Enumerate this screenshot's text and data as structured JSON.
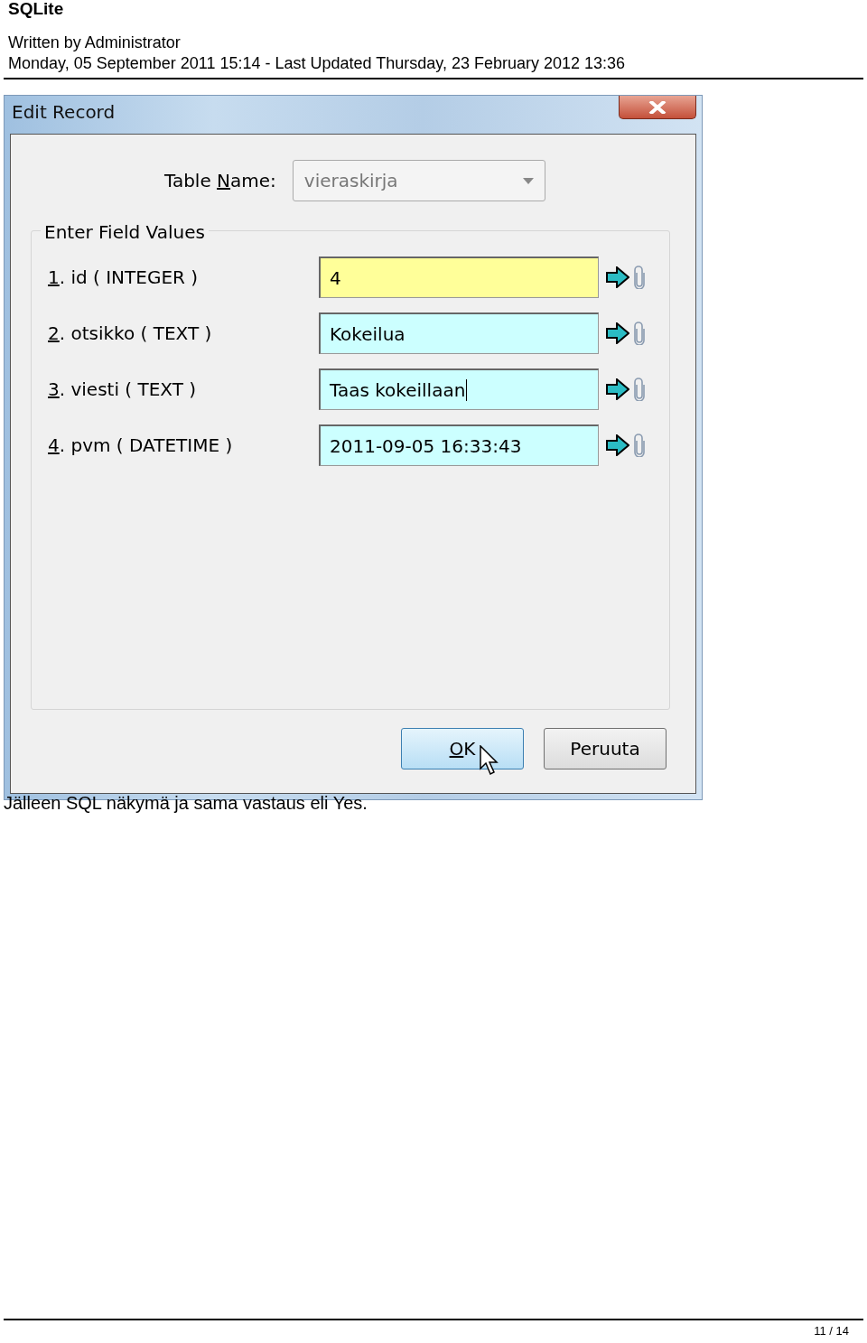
{
  "header": {
    "title": "SQLite",
    "author": "Written by Administrator",
    "dates": "Monday, 05 September 2011 15:14 - Last Updated Thursday, 23 February 2012 13:36"
  },
  "dialog": {
    "title": "Edit Record",
    "table_name_label": {
      "before": "Table ",
      "mnemonic": "N",
      "after": "ame:"
    },
    "table_name": "vieraskirja",
    "group_title": "Enter Field Values",
    "fields": [
      {
        "mnemonic": "1",
        "label": ". id ( INTEGER )",
        "value": "4",
        "color": "#ffff99",
        "focused": false
      },
      {
        "mnemonic": "2",
        "label": ". otsikko ( TEXT )",
        "value": "Kokeilua",
        "color": "#ccffff",
        "focused": false
      },
      {
        "mnemonic": "3",
        "label": ". viesti ( TEXT )",
        "value": "Taas kokeillaan",
        "color": "#ccffff",
        "focused": true
      },
      {
        "mnemonic": "4",
        "label": ". pvm ( DATETIME )",
        "value": "2011-09-05 16:33:43",
        "color": "#ccffff",
        "focused": false
      }
    ],
    "buttons": [
      {
        "mnemonic": "O",
        "label": "K",
        "default": true
      },
      {
        "label": "Peruuta",
        "default": false
      }
    ]
  },
  "caption": "Jälleen SQL näkymä ja sama vastaus eli Yes.",
  "footer": {
    "page": "11 / 14"
  }
}
